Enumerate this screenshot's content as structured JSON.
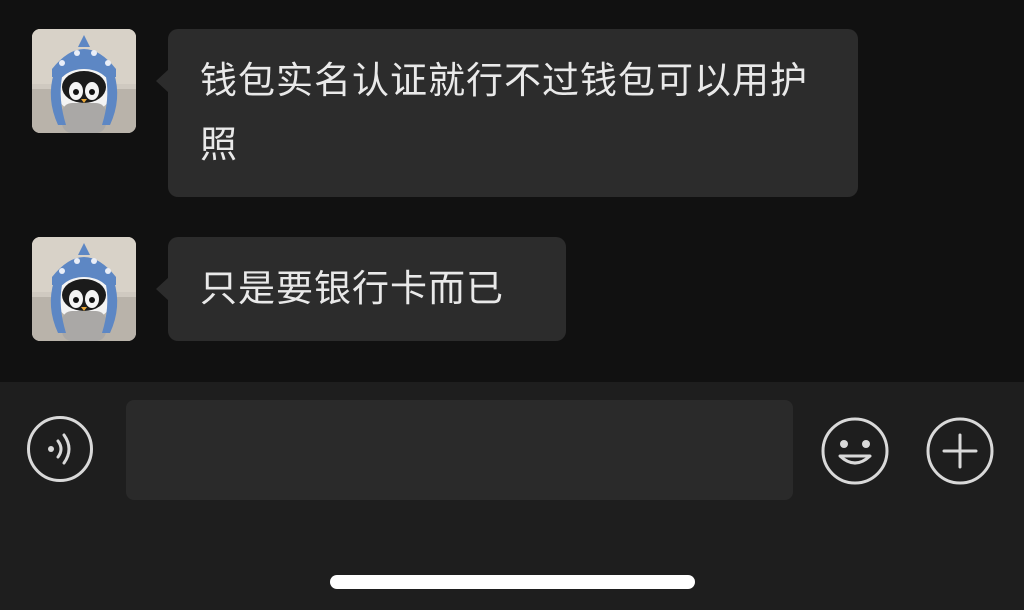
{
  "messages": [
    {
      "sender_avatar": "penguin-shark-hat-avatar",
      "text": "钱包实名认证就行不过钱包可以用护照"
    },
    {
      "sender_avatar": "penguin-shark-hat-avatar",
      "text": "只是要银行卡而已"
    }
  ],
  "input_bar": {
    "voice_icon": "voice-icon",
    "message_value": "",
    "emoji_icon": "emoji-icon",
    "plus_icon": "plus-icon"
  },
  "colors": {
    "background": "#111111",
    "bubble": "#2c2c2c",
    "input_bar": "#1e1e1e",
    "text": "#e9e9e9"
  }
}
